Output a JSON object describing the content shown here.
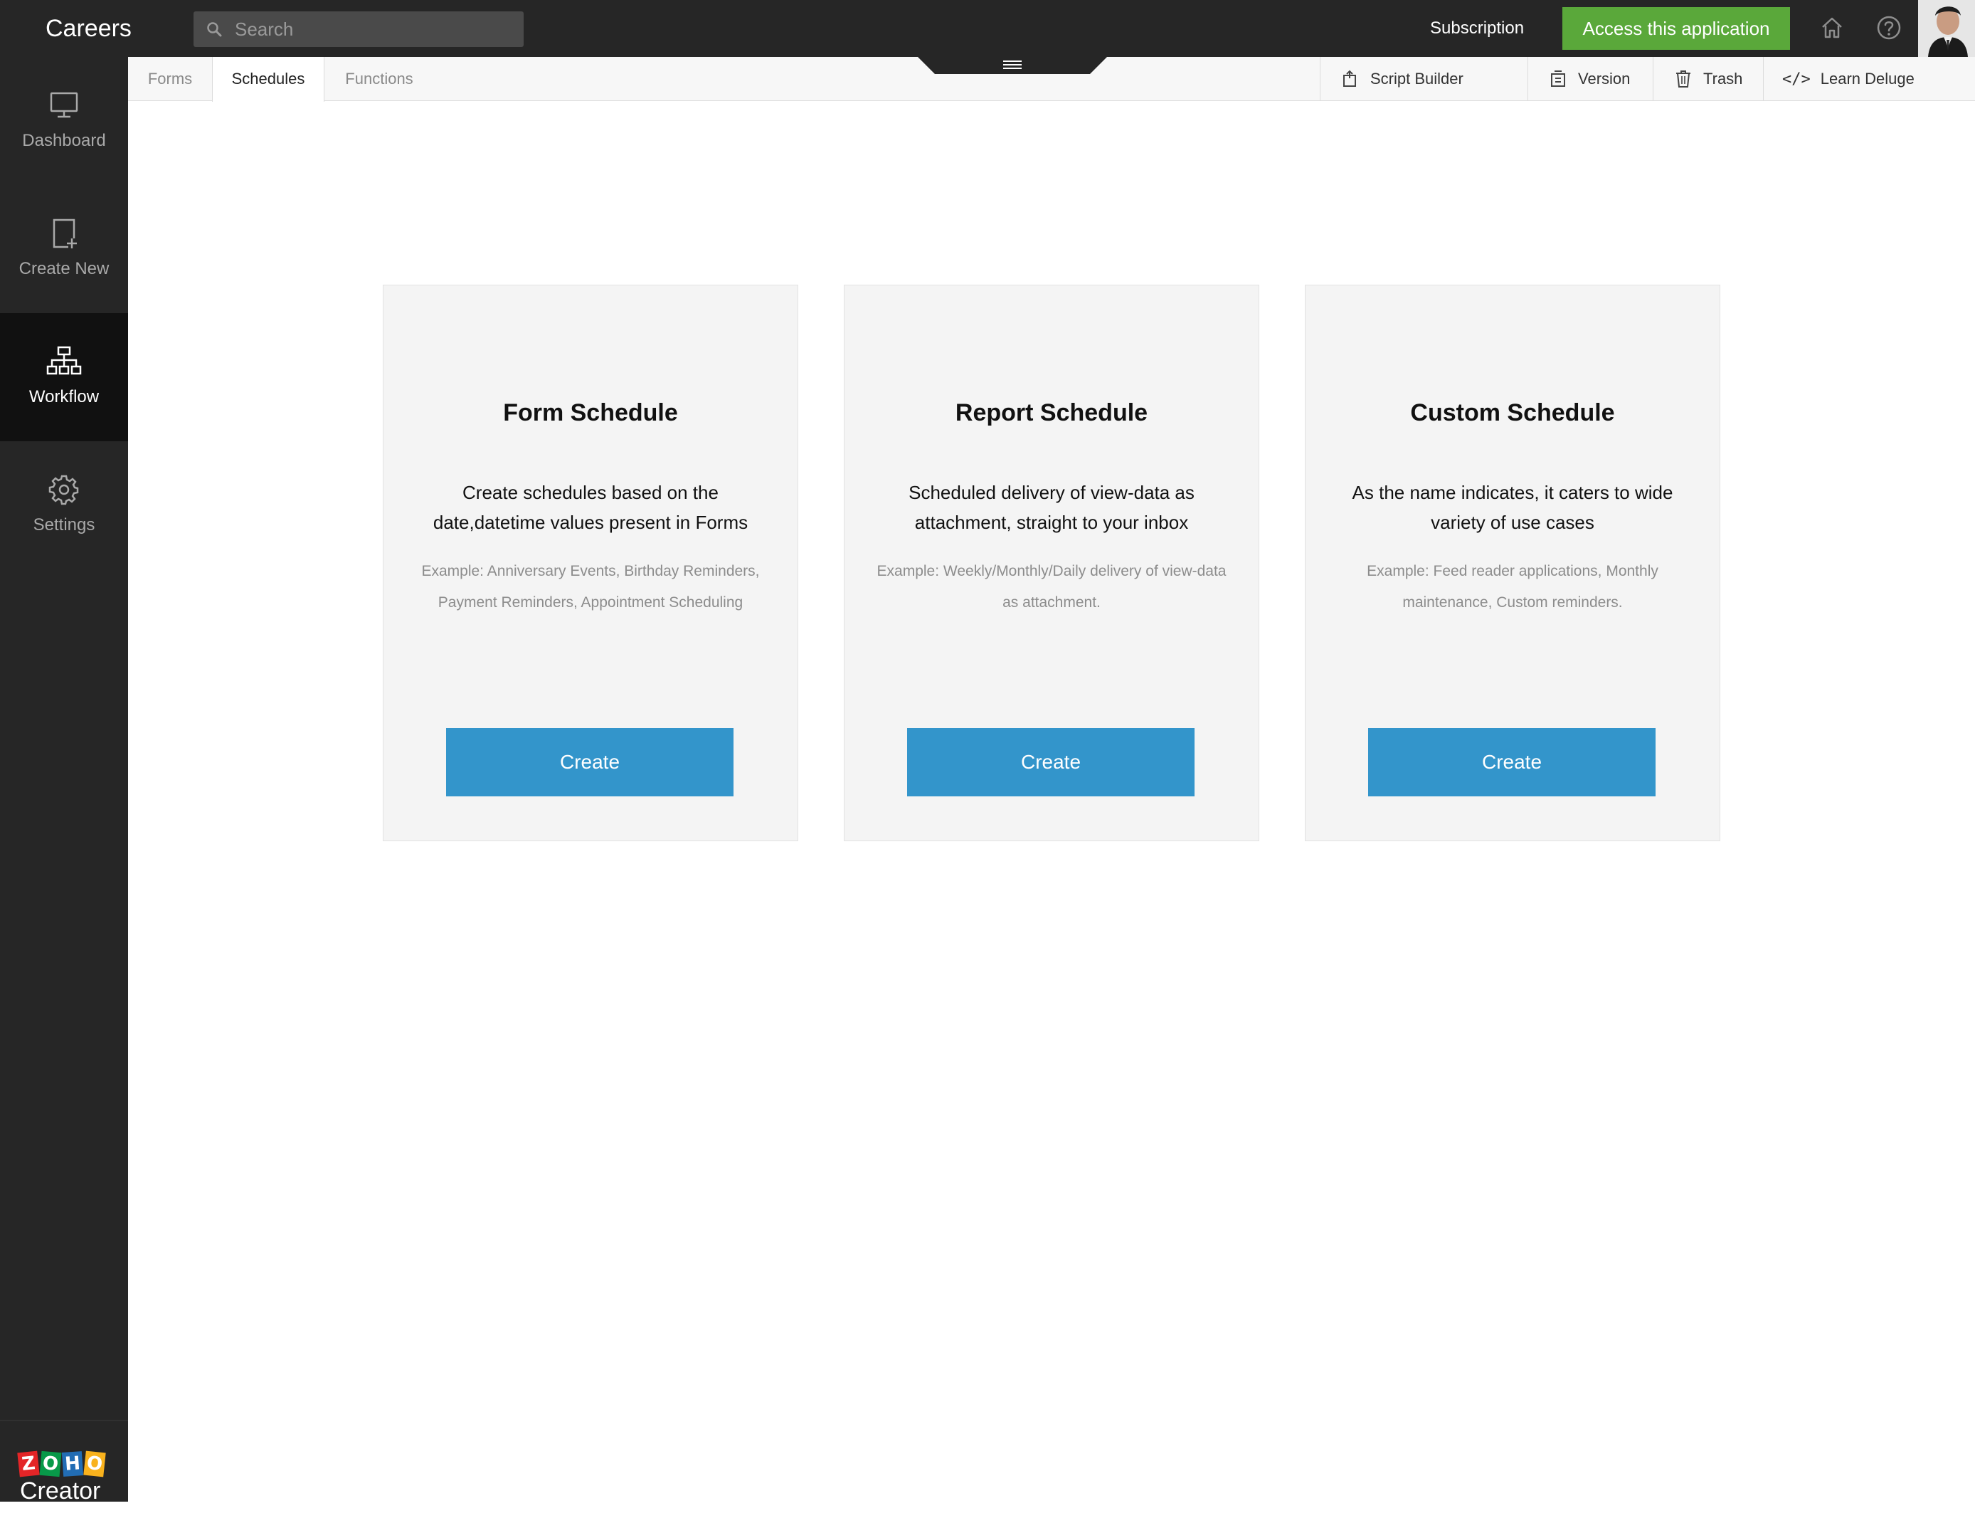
{
  "app": {
    "title": "Careers"
  },
  "search": {
    "placeholder": "Search"
  },
  "topbar": {
    "subscription_label": "Subscription",
    "access_label": "Access this application",
    "access_color": "#5aa83a",
    "icons": [
      "search-icon",
      "home-icon",
      "help-icon"
    ]
  },
  "sidebar": {
    "items": [
      {
        "label": "Dashboard",
        "icon": "monitor-icon",
        "active": false
      },
      {
        "label": "Create New",
        "icon": "new-page-icon",
        "active": false
      },
      {
        "label": "Workflow",
        "icon": "workflow-icon",
        "active": true
      },
      {
        "label": "Settings",
        "icon": "gear-icon",
        "active": false
      }
    ],
    "brand": {
      "letters": [
        "Z",
        "O",
        "H",
        "O"
      ],
      "word": "Creator",
      "letter_colors": [
        "#e42527",
        "#089949",
        "#226db4",
        "#f9b21d"
      ]
    }
  },
  "tabs": [
    {
      "label": "Forms",
      "active": false
    },
    {
      "label": "Schedules",
      "active": true
    },
    {
      "label": "Functions",
      "active": false
    }
  ],
  "toolbar": {
    "script_builder": "Script Builder",
    "version": "Version",
    "trash": "Trash",
    "learn_deluge": "Learn Deluge",
    "learn_deluge_glyph": "</>"
  },
  "cards": [
    {
      "title": "Form Schedule",
      "description": "Create schedules based on the date,datetime values present in Forms",
      "example": "Example: Anniversary Events, Birthday Reminders, Payment Reminders, Appointment Scheduling",
      "button": "Create"
    },
    {
      "title": "Report Schedule",
      "description": "Scheduled delivery of view-data as attachment, straight to your inbox",
      "example": "Example: Weekly/Monthly/Daily delivery of view-data as attachment.",
      "button": "Create"
    },
    {
      "title": "Custom Schedule",
      "description": "As the name indicates, it caters to wide variety of use cases",
      "example": "Example: Feed reader applications, Monthly maintenance, Custom reminders.",
      "button": "Create"
    }
  ],
  "colors": {
    "topbar": "#262626",
    "sidebar": "#262626",
    "sidebar_active": "#111111",
    "card_bg": "#f4f4f4",
    "create_button": "#3395cb"
  }
}
